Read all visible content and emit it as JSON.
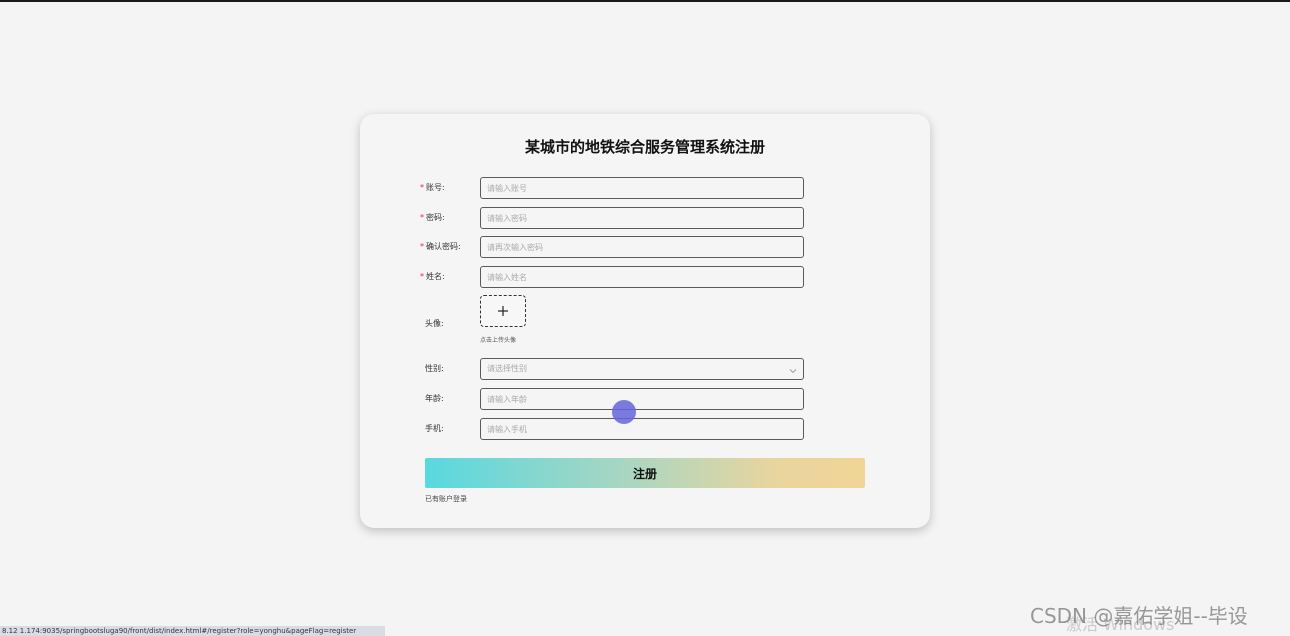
{
  "form": {
    "title": "某城市的地铁综合服务管理系统注册",
    "fields": [
      {
        "label": "账号:",
        "required": true,
        "placeholder": "请输入账号"
      },
      {
        "label": "密码:",
        "required": true,
        "placeholder": "请输入密码"
      },
      {
        "label": "确认密码:",
        "required": true,
        "placeholder": "请再次输入密码"
      },
      {
        "label": "姓名:",
        "required": true,
        "placeholder": "请输入姓名"
      }
    ],
    "avatar": {
      "label": "头像:",
      "hint": "点击上传头像"
    },
    "gender": {
      "label": "性别:",
      "placeholder": "请选择性别"
    },
    "age": {
      "label": "年龄:",
      "placeholder": "请输入年龄"
    },
    "phone": {
      "label": "手机:",
      "placeholder": "请输入手机"
    },
    "submit_label": "注册",
    "login_link": "已有账户登录",
    "required_mark": "*"
  },
  "browser": {
    "status_url": "8.12  1.174:9035/springbootsluga90/front/dist/index.html#/register?role=yonghu&pageFlag=register"
  },
  "overlay": {
    "watermark": "CSDN @嘉佑学姐--毕设",
    "activation": "激活 Windows"
  },
  "colors": {
    "required": "#e3263d",
    "button_gradient_start": "#58d8df",
    "button_gradient_end": "#f0d596"
  }
}
